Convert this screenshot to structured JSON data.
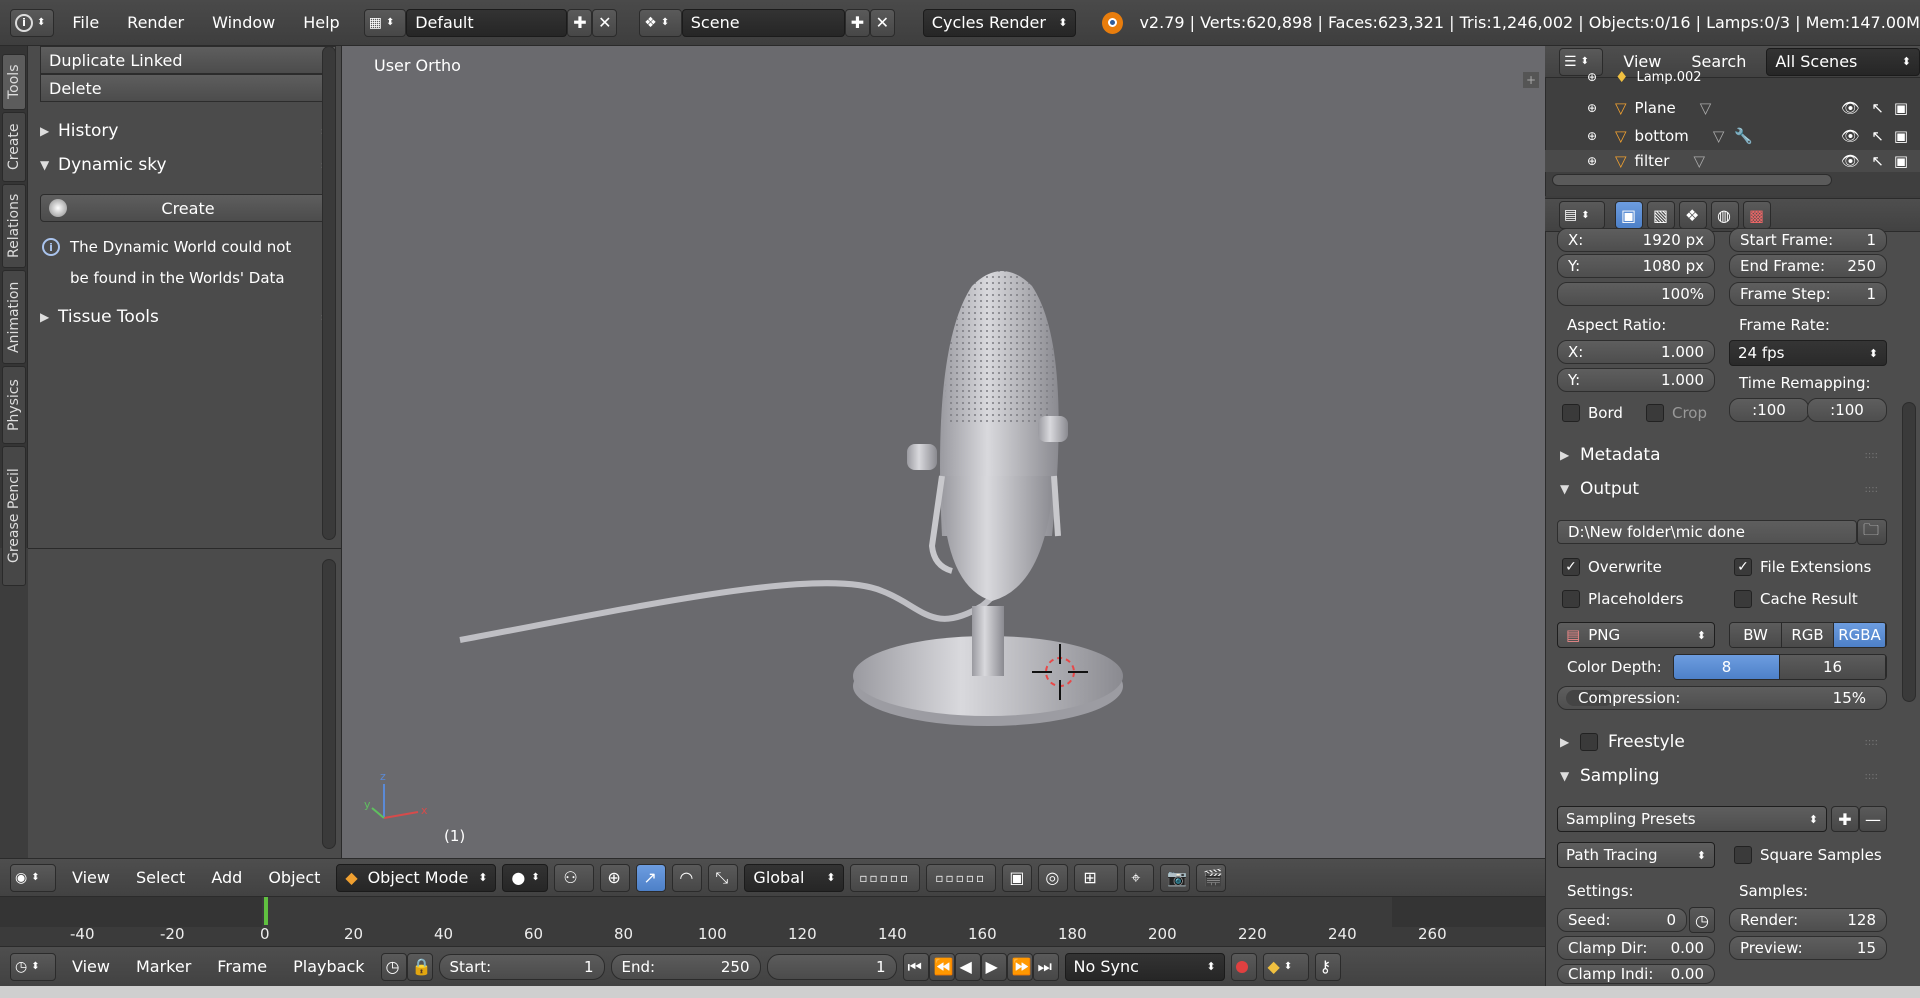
{
  "topbar": {
    "menus": [
      "File",
      "Render",
      "Window",
      "Help"
    ],
    "layout": "Default",
    "scene": "Scene",
    "engine": "Cycles Render",
    "stats": "v2.79 | Verts:620,898 | Faces:623,321 | Tris:1,246,002 | Objects:0/16 | Lamps:0/3 | Mem:147.00M"
  },
  "tabs": [
    "Tools",
    "Create",
    "Relations",
    "Animation",
    "Physics",
    "Grease Pencil"
  ],
  "toolshelf": {
    "buttons": [
      "Duplicate Linked",
      "Delete"
    ],
    "history": "History",
    "dynamic_sky": "Dynamic sky",
    "create": "Create",
    "info_line1": "The Dynamic World could not",
    "info_line2": "be found in the Worlds' Data",
    "tissue": "Tissue Tools"
  },
  "viewport": {
    "label": "User Ortho",
    "frame": "(1)"
  },
  "view_header": {
    "menus": [
      "View",
      "Select",
      "Add",
      "Object"
    ],
    "mode": "Object Mode",
    "orientation": "Global"
  },
  "timeline": {
    "ticks": [
      "-40",
      "-20",
      "0",
      "20",
      "40",
      "60",
      "80",
      "100",
      "120",
      "140",
      "160",
      "180",
      "200",
      "220",
      "240",
      "260"
    ],
    "menus": [
      "View",
      "Marker",
      "Frame",
      "Playback"
    ],
    "start_label": "Start:",
    "start": "1",
    "end_label": "End:",
    "end": "250",
    "current": "1",
    "sync": "No Sync"
  },
  "outliner": {
    "menus": [
      "View",
      "Search"
    ],
    "filter": "All Scenes",
    "rows": [
      "Lamp.002",
      "Plane",
      "bottom",
      "filter"
    ]
  },
  "props": {
    "res_x_label": "X:",
    "res_x": "1920 px",
    "res_y_label": "Y:",
    "res_y": "1080 px",
    "res_pct": "100%",
    "start_frame_label": "Start Frame:",
    "start_frame": "1",
    "end_frame_label": "End Frame:",
    "end_frame": "250",
    "frame_step_label": "Frame Step:",
    "frame_step": "1",
    "aspect_label": "Aspect Ratio:",
    "aspect_x_label": "X:",
    "aspect_x": "1.000",
    "aspect_y_label": "Y:",
    "aspect_y": "1.000",
    "frame_rate_label": "Frame Rate:",
    "frame_rate": "24 fps",
    "time_remap_label": "Time Remapping:",
    "remap_old": ":100",
    "remap_new": ":100",
    "bord": "Bord",
    "crop": "Crop",
    "metadata": "Metadata",
    "output": "Output",
    "output_path": "D:\\New folder\\mic done",
    "overwrite": "Overwrite",
    "file_ext": "File Extensions",
    "placeholders": "Placeholders",
    "cache_result": "Cache Result",
    "format": "PNG",
    "color_modes": [
      "BW",
      "RGB",
      "RGBA"
    ],
    "color_depth_label": "Color Depth:",
    "depths": [
      "8",
      "16"
    ],
    "compression_label": "Compression:",
    "compression": "15%",
    "compression_level": 0.15,
    "freestyle": "Freestyle",
    "sampling": "Sampling",
    "sampling_presets": "Sampling Presets",
    "integrator": "Path Tracing",
    "square_samples": "Square Samples",
    "settings_label": "Settings:",
    "samples_label": "Samples:",
    "seed_label": "Seed:",
    "seed": "0",
    "render_label": "Render:",
    "render": "128",
    "clamp_dir_label": "Clamp Dir:",
    "clamp_dir": "0.00",
    "preview_label": "Preview:",
    "preview": "15",
    "clamp_ind_label": "Clamp Indi:",
    "clamp_ind": "0.00"
  },
  "colors": {
    "accent": "#5b8ad6",
    "viewport": "#6a6a6e",
    "panel": "#4d4d4d"
  }
}
